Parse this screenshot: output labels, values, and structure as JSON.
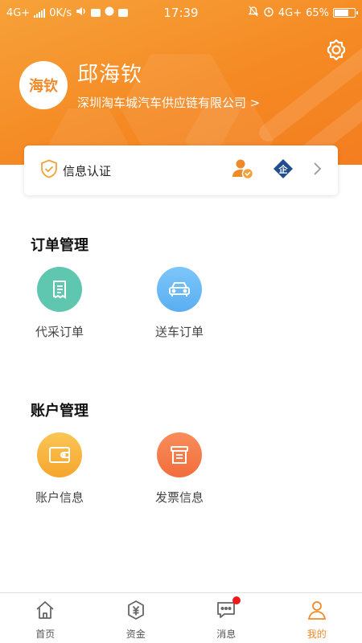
{
  "status_bar": {
    "network": "4G+",
    "speed": "0K/s",
    "time": "17:39",
    "network_right": "4G+",
    "battery": "65%"
  },
  "profile": {
    "avatar_text": "海钦",
    "name": "邱海钦",
    "company": "深圳淘车城汽车供应链有限公司 >"
  },
  "auth": {
    "label": "信息认证",
    "enterprise_badge": "企"
  },
  "sections": {
    "orders": {
      "title": "订单管理",
      "items": [
        {
          "label": "代采订单",
          "icon": "receipt-icon",
          "color": "#5fc6b0"
        },
        {
          "label": "送车订单",
          "icon": "car-icon",
          "color": "#6cb9f5"
        }
      ]
    },
    "account": {
      "title": "账户管理",
      "items": [
        {
          "label": "账户信息",
          "icon": "wallet-icon",
          "color": "#f7b53e"
        },
        {
          "label": "发票信息",
          "icon": "invoice-icon",
          "color": "#f57a4a"
        }
      ]
    }
  },
  "nav": {
    "items": [
      {
        "label": "首页",
        "icon": "home-icon"
      },
      {
        "label": "资金",
        "icon": "funds-icon"
      },
      {
        "label": "消息",
        "icon": "message-icon"
      },
      {
        "label": "我的",
        "icon": "profile-icon",
        "active": true
      }
    ]
  },
  "colors": {
    "accent": "#f08a28",
    "header_gradient_start": "#f7a23a",
    "header_gradient_end": "#f47d1f",
    "badge": "#ee1a1a"
  }
}
